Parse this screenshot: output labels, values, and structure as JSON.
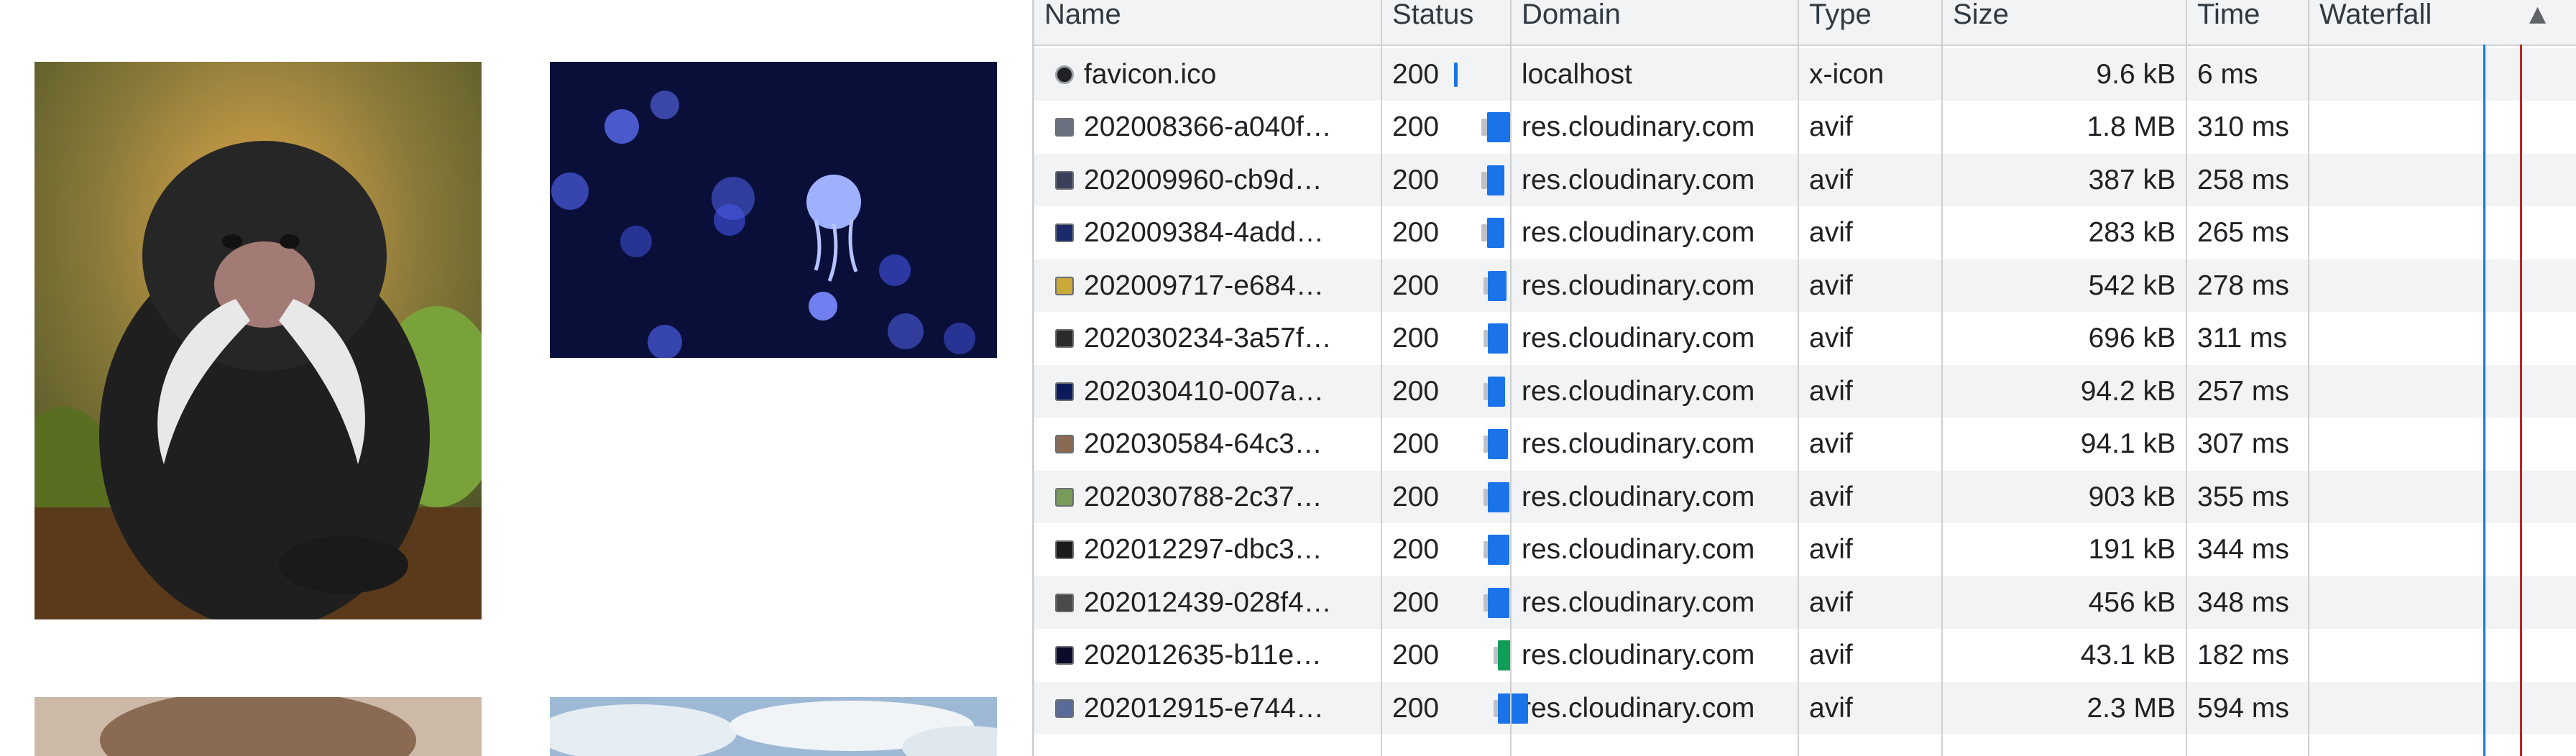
{
  "columns": [
    {
      "key": "name",
      "label": "Name"
    },
    {
      "key": "status",
      "label": "Status"
    },
    {
      "key": "domain",
      "label": "Domain"
    },
    {
      "key": "type",
      "label": "Type"
    },
    {
      "key": "size",
      "label": "Size"
    },
    {
      "key": "time",
      "label": "Time"
    },
    {
      "key": "waterfall",
      "label": "Waterfall"
    }
  ],
  "sort_indicator": "▲",
  "rows": [
    {
      "name": "favicon.ico",
      "status": "200",
      "domain": "localhost",
      "type": "x-icon",
      "size": "9.6 kB",
      "time": "6 ms",
      "icon": "favicon-icon"
    },
    {
      "name": "202008366-a040f…",
      "status": "200",
      "domain": "res.cloudinary.com",
      "type": "avif",
      "size": "1.8 MB",
      "time": "310 ms",
      "icon": "image-thumbnail-icon"
    },
    {
      "name": "202009960-cb9d…",
      "status": "200",
      "domain": "res.cloudinary.com",
      "type": "avif",
      "size": "387 kB",
      "time": "258 ms",
      "icon": "image-thumbnail-icon"
    },
    {
      "name": "202009384-4add…",
      "status": "200",
      "domain": "res.cloudinary.com",
      "type": "avif",
      "size": "283 kB",
      "time": "265 ms",
      "icon": "image-thumbnail-icon"
    },
    {
      "name": "202009717-e684…",
      "status": "200",
      "domain": "res.cloudinary.com",
      "type": "avif",
      "size": "542 kB",
      "time": "278 ms",
      "icon": "image-thumbnail-icon"
    },
    {
      "name": "202030234-3a57f…",
      "status": "200",
      "domain": "res.cloudinary.com",
      "type": "avif",
      "size": "696 kB",
      "time": "311 ms",
      "icon": "image-thumbnail-icon"
    },
    {
      "name": "202030410-007a…",
      "status": "200",
      "domain": "res.cloudinary.com",
      "type": "avif",
      "size": "94.2 kB",
      "time": "257 ms",
      "icon": "image-thumbnail-icon"
    },
    {
      "name": "202030584-64c3…",
      "status": "200",
      "domain": "res.cloudinary.com",
      "type": "avif",
      "size": "94.1 kB",
      "time": "307 ms",
      "icon": "image-thumbnail-icon"
    },
    {
      "name": "202030788-2c37…",
      "status": "200",
      "domain": "res.cloudinary.com",
      "type": "avif",
      "size": "903 kB",
      "time": "355 ms",
      "icon": "image-thumbnail-icon"
    },
    {
      "name": "202012297-dbc3…",
      "status": "200",
      "domain": "res.cloudinary.com",
      "type": "avif",
      "size": "191 kB",
      "time": "344 ms",
      "icon": "image-thumbnail-icon"
    },
    {
      "name": "202012439-028f4…",
      "status": "200",
      "domain": "res.cloudinary.com",
      "type": "avif",
      "size": "456 kB",
      "time": "348 ms",
      "icon": "image-thumbnail-icon"
    },
    {
      "name": "202012635-b11e…",
      "status": "200",
      "domain": "res.cloudinary.com",
      "type": "avif",
      "size": "43.1 kB",
      "time": "182 ms",
      "icon": "image-thumbnail-icon"
    },
    {
      "name": "202012915-e744…",
      "status": "200",
      "domain": "res.cloudinary.com",
      "type": "avif",
      "size": "2.3 MB",
      "time": "594 ms",
      "icon": "image-thumbnail-icon"
    }
  ],
  "colors": {
    "header_bg": "#f1f3f4",
    "row_alt_bg": "#f1f3f4",
    "row_bg": "#ffffff",
    "waterfall_blue": "#1a73e8",
    "waterfall_green": "#0f9d58",
    "dom_content_loaded_line": "#1a73e8",
    "load_line": "#c5221f"
  }
}
